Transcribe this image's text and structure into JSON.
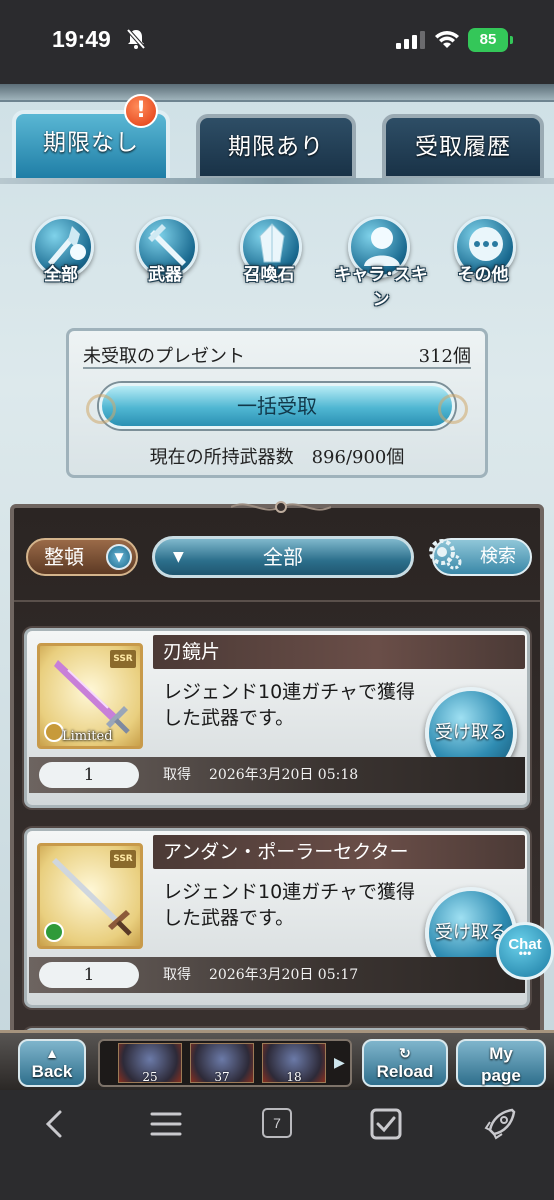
{
  "status": {
    "time": "19:49",
    "battery": "85"
  },
  "tabs": [
    {
      "label": "期限なし",
      "active": true
    },
    {
      "label": "期限あり",
      "active": false
    },
    {
      "label": "受取履歴",
      "active": false
    }
  ],
  "alert_badge": "!",
  "categories": [
    {
      "label": "全部",
      "icon": "all-icon"
    },
    {
      "label": "武器",
      "icon": "weapon-icon"
    },
    {
      "label": "召喚石",
      "icon": "summon-stone-icon"
    },
    {
      "label": "キャラ･スキン",
      "icon": "character-icon"
    },
    {
      "label": "その他",
      "icon": "other-icon"
    }
  ],
  "present": {
    "title": "未受取のプレゼント",
    "count": "312個",
    "bulk_label": "一括受取",
    "owned_text": "現在の所持武器数　896/900個"
  },
  "controls": {
    "sort_label": "整頓",
    "filter_label": "全部",
    "search_label": "検索"
  },
  "items": [
    {
      "name": "刃鏡片",
      "description": "レジェンド10連ガチャで獲得した武器です。",
      "receive_label": "受け取る",
      "quantity": "1",
      "acquired_label": "取得",
      "date": "2026年3月20日 05:18",
      "rarity": "SSR",
      "limited": "Limited",
      "element_color": "#c79a3a"
    },
    {
      "name": "アンダン・ポーラーセクター",
      "description": "レジェンド10連ガチャで獲得した武器です。",
      "receive_label": "受け取る",
      "quantity": "1",
      "acquired_label": "取得",
      "date": "2026年3月20日 05:17",
      "rarity": "SSR",
      "limited": "",
      "element_color": "#2f9a3a"
    }
  ],
  "chat": {
    "label": "Chat",
    "dots": "•••"
  },
  "game_nav": {
    "back_label": "Back",
    "reload_label": "Reload",
    "mypage_top": "My",
    "mypage_bottom": "page",
    "party": [
      "25",
      "37",
      "18"
    ]
  },
  "browser": {
    "tabs_count": "7"
  }
}
